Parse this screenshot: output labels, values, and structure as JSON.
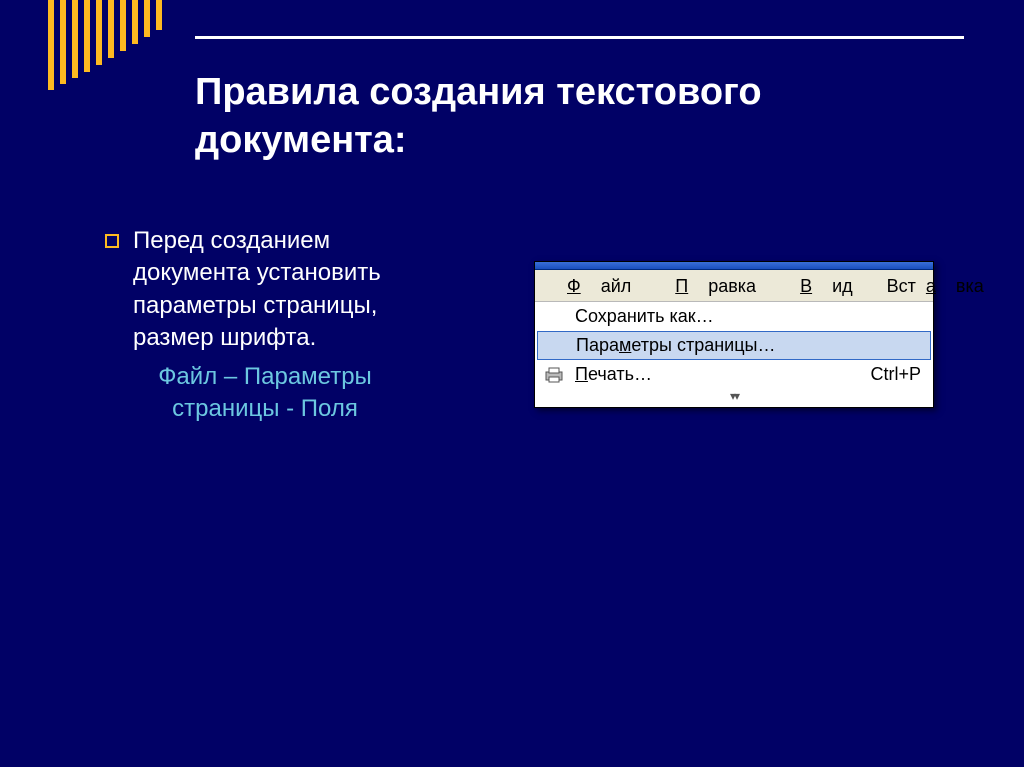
{
  "title_line1": "Правила создания текстового",
  "title_line2": "документа:",
  "bullet_text": "Перед созданием документа установить параметры страницы, размер шрифта.",
  "sub_text": "Файл – Параметры страницы - Поля",
  "menubar": {
    "file": "Файл",
    "edit": "Правка",
    "view": "Вид",
    "insert": "Вставка"
  },
  "dropdown": {
    "save_as": "Сохранить как…",
    "page_setup": "Параметры страницы…",
    "print": "Печать…",
    "print_shortcut": "Ctrl+P"
  }
}
